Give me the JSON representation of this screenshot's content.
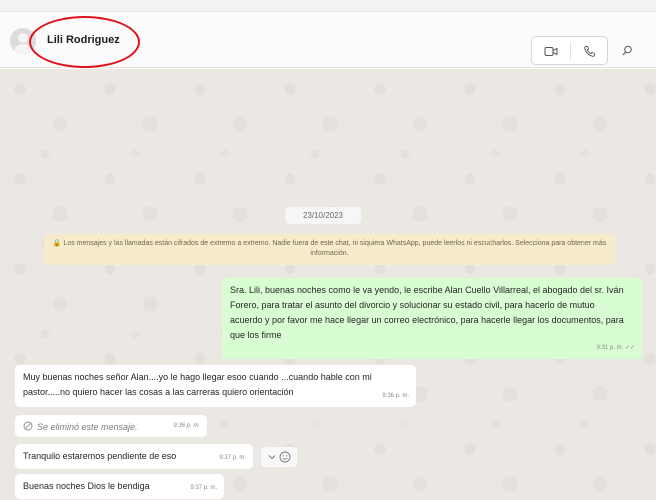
{
  "header": {
    "contact_name": "Lili Rodriguez",
    "icons": [
      "avatar-icon",
      "video-call-icon",
      "phone-icon",
      "search-icon"
    ]
  },
  "chat": {
    "date": "23/10/2023",
    "encryption_notice": "🔒 Los mensajes y las llamadas están cifrados de extremo a extremo. Nadie fuera de este chat, ni siquiera WhatsApp, puede leerlos ni escucharlos. Selecciona para obtener más información.",
    "messages": [
      {
        "direction": "outgoing",
        "text": "Sra. Lili, buenas noches como le va yendo, le escribe Alan Cuello Villarreal, el abogado del sr. Iván Forero, para tratar el asunto del divorcio y solucionar su estado civil, para hacerlo de mutuo acuerdo y por favor me hace llegar un correo electrónico, para hacerle llegar los documentos, para que los firme",
        "time": "9:31 p. m. ✓✓"
      },
      {
        "direction": "incoming",
        "text": "Muy buenas noches señor Alan....yo le hago llegar esoo cuando ...cuando hable con mi pastor.....no quiero hacer las cosas a las carreras quiero orientación",
        "time": "9:36 p. m."
      },
      {
        "direction": "incoming",
        "text": "Se eliminó este mensaje.",
        "time": "9:36 p. m.",
        "deleted": true
      },
      {
        "direction": "incoming",
        "text": "Tranquilo estaremos pendiente de eso",
        "time": "9:37 p. m."
      },
      {
        "direction": "incoming",
        "text": "Buenas noches Dios le bendiga",
        "time": "9:37 p. m."
      }
    ]
  },
  "colors": {
    "outgoing_bubble": "#d9fdd3",
    "incoming_bubble": "#ffffff",
    "chat_background": "#ebe7e2",
    "notice_background": "#f7ecc9",
    "annotation_ring": "#e0131b"
  }
}
